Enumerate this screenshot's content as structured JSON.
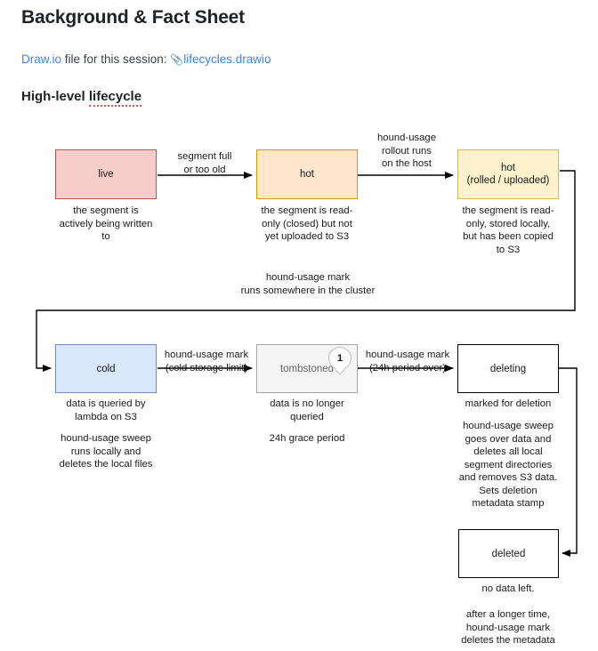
{
  "header": {
    "title": "Background & Fact Sheet",
    "session_prefix": "Draw.io",
    "session_middle": " file for this session: ",
    "attachment_icon": "paperclip-icon",
    "session_file": "lifecycles.drawio",
    "section_title_a": "High-level ",
    "section_title_b": "lifecycle"
  },
  "colors": {
    "link": "#3a87f2",
    "live_fill": "#f8cecc",
    "live_stroke": "#b85450",
    "hot_fill": "#ffe6cc",
    "hot_stroke": "#d79b00",
    "hot_rolled_fill": "#fff2cc",
    "hot_rolled_stroke": "#d6b656",
    "cold_fill": "#dae8fc",
    "cold_stroke": "#6c8ebf",
    "tombstoned_fill": "#f5f5f5",
    "tombstoned_stroke": "#a6a6a6",
    "plain_fill": "#ffffff",
    "plain_stroke": "#000000"
  },
  "diagram": {
    "type": "state-lifecycle-flowchart",
    "nodes": [
      {
        "id": "live",
        "label": "live",
        "caption": "the segment is\nactively being written\nto"
      },
      {
        "id": "hot",
        "label": "hot",
        "caption": "the segment is read-\nonly (closed) but not\nyet uploaded to S3"
      },
      {
        "id": "hot-rolled",
        "label": "hot\n(rolled / uploaded)",
        "caption": "the segment is read-\nonly, stored locally,\nbut has been copied\nto S3"
      },
      {
        "id": "cold",
        "label": "cold",
        "caption": "data is queried by\nlambda on S3",
        "caption2": "hound-usage sweep\nruns locally and\ndeletes the local files"
      },
      {
        "id": "tombstoned",
        "label": "tombstoned",
        "badge": "1",
        "caption": "data is no longer\nqueried",
        "caption2": "24h grace period"
      },
      {
        "id": "deleting",
        "label": "deleting",
        "caption": "marked for deletion",
        "caption2": "hound-usage sweep\ngoes over data and\ndeletes all local\nsegment directories\nand removes S3 data.\nSets deletion\nmetadata stamp"
      },
      {
        "id": "deleted",
        "label": "deleted",
        "caption": "no data left.",
        "caption2": "after a longer time,\nhound-usage mark\ndeletes the metadata"
      }
    ],
    "edges": [
      {
        "id": "live-hot",
        "from": "live",
        "to": "hot",
        "label": "segment full\nor too old"
      },
      {
        "id": "hot-hotrolled",
        "from": "hot",
        "to": "hot-rolled",
        "label": "hound-usage\nrollout runs\non the host"
      },
      {
        "id": "hotrolled-cold",
        "from": "hot-rolled",
        "to": "cold",
        "label": "hound-usage mark\nruns somewhere in the cluster"
      },
      {
        "id": "cold-tombstoned",
        "from": "cold",
        "to": "tombstoned",
        "label": "hound-usage mark\n(cold storage limit)"
      },
      {
        "id": "tombstoned-deleting",
        "from": "tombstoned",
        "to": "deleting",
        "label": "hound-usage mark\n(24h period over)"
      },
      {
        "id": "deleting-deleted",
        "from": "deleting",
        "to": "deleted",
        "label": ""
      }
    ]
  }
}
